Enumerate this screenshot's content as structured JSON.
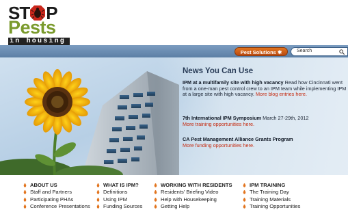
{
  "brand": {
    "logo_top_st": "ST",
    "logo_top_p": "P",
    "logo_pests": "Pests",
    "logo_bar": "in housing"
  },
  "topnav": {
    "pest_solutions_label": "Pest Solutions",
    "search_placeholder": "Search"
  },
  "news": {
    "title": "News You Can Use",
    "items": [
      {
        "headline": "IPM at a multifamily site with high vacancy",
        "body": " Read how Cincinnati went from a one-man pest control crew to an IPM team while implementing IPM at a large site with high vacancy.",
        "link": "More blog entries here."
      },
      {
        "headline": "7th International IPM Symposium",
        "body": " March 27-29th, 2012",
        "link": "More training opportunities here."
      },
      {
        "headline": "CA Pest Management Alliance Grants Program",
        "body": "",
        "link": "More funding opportunities here."
      }
    ]
  },
  "footer": {
    "columns": [
      {
        "heading": "ABOUT US",
        "items": [
          "Staff and Partners",
          "Participating PHAs",
          "Conference Presentations"
        ]
      },
      {
        "heading": "WHAT IS IPM?",
        "items": [
          "Definitions",
          "Using IPM",
          "Funding Sources"
        ]
      },
      {
        "heading": "WORKING WITH RESIDENTS",
        "items": [
          "Residents' Briefing Video",
          "Help with Housekeeping",
          "Getting Help"
        ]
      },
      {
        "heading": "IPM TRAINING",
        "items": [
          "The Training Day",
          "Training Materials",
          "Training Opportunities"
        ]
      }
    ]
  },
  "colors": {
    "accent_orange": "#e2751f",
    "link_red": "#c52a0f",
    "logo_green": "#7a9a2c",
    "band_blue": "#5c7fa5"
  }
}
